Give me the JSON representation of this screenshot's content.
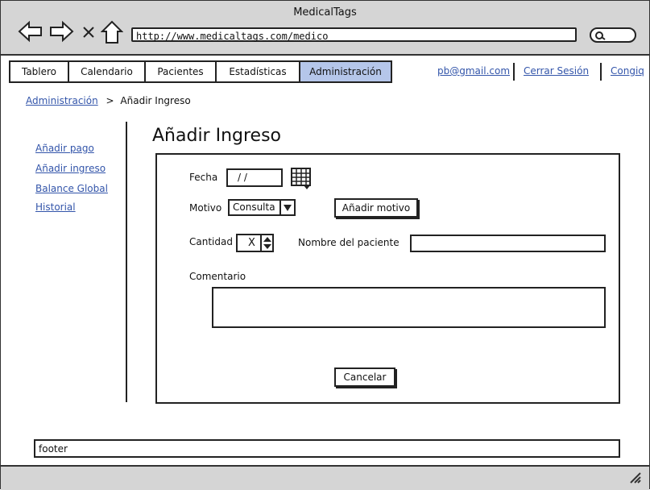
{
  "window": {
    "title": "MedicalTags"
  },
  "browser": {
    "url": "http://www.medicaltags.com/medico",
    "back_icon": "left-arrow",
    "forward_icon": "right-arrow",
    "stop_icon": "x",
    "home_icon": "house",
    "search_icon": "magnifier"
  },
  "tabs": [
    {
      "label": "Tablero"
    },
    {
      "label": "Calendario"
    },
    {
      "label": "Pacientes"
    },
    {
      "label": "Estadísticas"
    },
    {
      "label": "Administración",
      "active": true
    }
  ],
  "user_links": {
    "email": "pb@gmail.com",
    "logout": "Cerrar Sesión",
    "config": "Congiq"
  },
  "breadcrumb": {
    "parent": "Administración",
    "separator": ">",
    "current": "Añadir Ingreso"
  },
  "sidebar": {
    "items": [
      {
        "label": "Añadir pago"
      },
      {
        "label": "Añadir ingreso"
      },
      {
        "label": "Balance Global"
      },
      {
        "label": "Historial"
      }
    ]
  },
  "form": {
    "title": "Añadir Ingreso",
    "fecha_label": "Fecha",
    "fecha_value": "/ /",
    "motivo_label": "Motivo",
    "motivo_value": "Consulta",
    "add_motivo_button": "Añadir motivo",
    "cantidad_label": "Cantidad",
    "cantidad_value": "X",
    "paciente_label": "Nombre del paciente",
    "paciente_value": "",
    "comentario_label": "Comentario",
    "comentario_value": "",
    "cancel_button": "Cancelar"
  },
  "footer": {
    "text": "footer"
  },
  "colors": {
    "chrome": "#d5d5d5",
    "active_tab": "#b5c6ea",
    "link": "#3355aa"
  }
}
